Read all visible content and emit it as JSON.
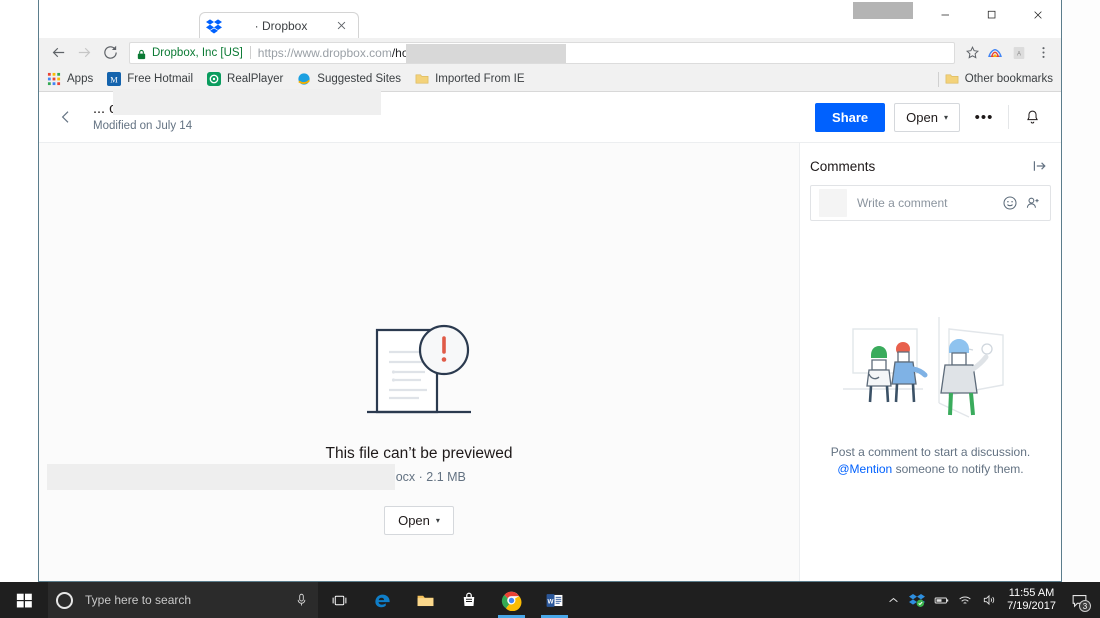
{
  "browser": {
    "tab": {
      "title": "· Dropbox",
      "favicon": "dropbox-icon",
      "close": "×"
    },
    "window_controls": {
      "minimize": "–",
      "maximize": "□",
      "close": "×"
    },
    "nav": {
      "back": "←",
      "forward": "→",
      "reload": "⟳"
    },
    "omnibox": {
      "security_label": "Dropbox, Inc [US]",
      "url_protocol": "https://www.dropbox.com",
      "url_path": "/home/e",
      "star": "☆"
    },
    "bookmarks": [
      {
        "label": "Apps",
        "icon": "apps-grid-icon"
      },
      {
        "label": "Free Hotmail",
        "icon": "hotmail-icon"
      },
      {
        "label": "RealPlayer",
        "icon": "realplayer-icon"
      },
      {
        "label": "Suggested Sites",
        "icon": "internet-explorer-icon"
      },
      {
        "label": "Imported From IE",
        "icon": "folder-icon"
      }
    ],
    "other_bookmarks": {
      "label": "Other bookmarks",
      "icon": "folder-icon"
    }
  },
  "page_header": {
    "back": "‹",
    "file_name": "... comments.docx",
    "modified": "Modified on July 14",
    "share_label": "Share",
    "open_label": "Open",
    "open_caret": "▾",
    "more_label": "•••",
    "bell": "notification-bell-icon"
  },
  "preview": {
    "illustration": "document-warning-icon",
    "title": "This file can’t be previewed",
    "file_info": "ıts.docx · 2.1 MB",
    "open_label": "Open",
    "open_caret": "▾"
  },
  "comments": {
    "title": "Comments",
    "collapse_icon": "collapse-panel-icon",
    "composer": {
      "placeholder": "Write a comment",
      "emoji_icon": "emoji-smiley-icon",
      "mention_icon": "add-person-icon"
    },
    "empty_state": {
      "illustration": "people-discussion-illustration",
      "line1": "Post a comment to start a discussion.",
      "mention": "@Mention",
      "line2_rest": " someone to notify them."
    }
  },
  "taskbar": {
    "start": "windows-start-icon",
    "search_placeholder": "Type here to search",
    "mic": "microphone-icon",
    "items": [
      {
        "name": "task-view",
        "icon": "task-view-icon",
        "active": false
      },
      {
        "name": "edge",
        "icon": "microsoft-edge-icon",
        "active": false
      },
      {
        "name": "file-explorer",
        "icon": "file-explorer-icon",
        "active": false
      },
      {
        "name": "store",
        "icon": "microsoft-store-icon",
        "active": false
      },
      {
        "name": "chrome",
        "icon": "google-chrome-icon",
        "active": true
      },
      {
        "name": "word",
        "icon": "microsoft-word-icon",
        "active": true
      }
    ],
    "tray": [
      {
        "name": "show-hidden-icons",
        "icon": "chevron-up-icon"
      },
      {
        "name": "dropbox-tray",
        "icon": "dropbox-icon"
      },
      {
        "name": "battery",
        "icon": "battery-icon"
      },
      {
        "name": "network",
        "icon": "wifi-icon"
      },
      {
        "name": "volume",
        "icon": "speaker-icon"
      }
    ],
    "clock": {
      "time": "11:55 AM",
      "date": "7/19/2017"
    },
    "notifications": {
      "icon": "action-center-icon",
      "badge": "3"
    }
  },
  "colors": {
    "accent_blue": "#0061fe",
    "taskbar": "#1f1f1f",
    "chrome_toolbar": "#f1f1f1",
    "secure_green": "#0b7a34",
    "text_muted": "#637282"
  }
}
